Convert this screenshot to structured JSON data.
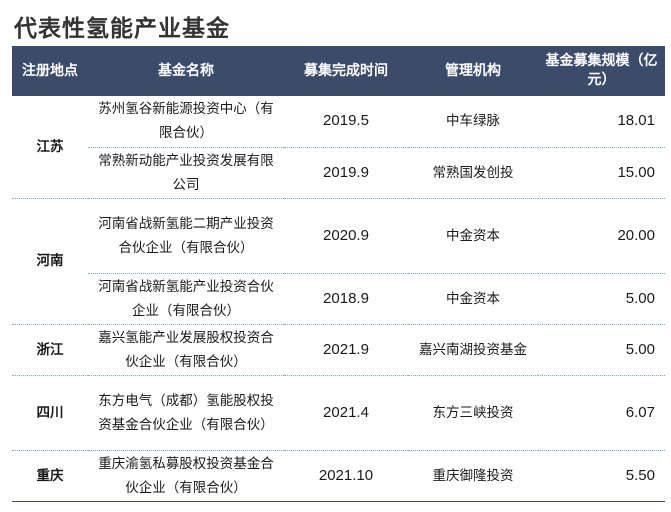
{
  "title": "代表性氢能产业基金",
  "headers": {
    "region": "注册地点",
    "fund": "基金名称",
    "date": "募集完成时间",
    "manager": "管理机构",
    "size": "基金募集规模（亿元）"
  },
  "rows": [
    {
      "region": "江苏",
      "fund": "苏州氢谷新能源投资中心（有限合伙）",
      "date": "2019.5",
      "manager": "中车绿脉",
      "size": "18.01"
    },
    {
      "fund": "常熟新动能产业投资发展有限公司",
      "date": "2019.9",
      "manager": "常熟国发创投",
      "size": "15.00"
    },
    {
      "region": "河南",
      "fund": "河南省战新氢能二期产业投资合伙企业（有限合伙）",
      "date": "2020.9",
      "manager": "中金资本",
      "size": "20.00"
    },
    {
      "fund": "河南省战新氢能产业投资合伙企业（有限合伙）",
      "date": "2018.9",
      "manager": "中金资本",
      "size": "5.00"
    },
    {
      "region": "浙江",
      "fund": "嘉兴氢能产业发展股权投资合伙企业（有限合伙）",
      "date": "2021.9",
      "manager": "嘉兴南湖投资基金",
      "size": "5.00"
    },
    {
      "region": "四川",
      "fund": "东方电气（成都）氢能股权投资基金合伙企业（有限合伙）",
      "date": "2021.4",
      "manager": "东方三峡投资",
      "size": "6.07"
    },
    {
      "region": "重庆",
      "fund": "重庆渝氢私募股权投资基金合伙企业（有限合伙）",
      "date": "2021.10",
      "manager": "重庆御隆投资",
      "size": "5.50"
    }
  ]
}
